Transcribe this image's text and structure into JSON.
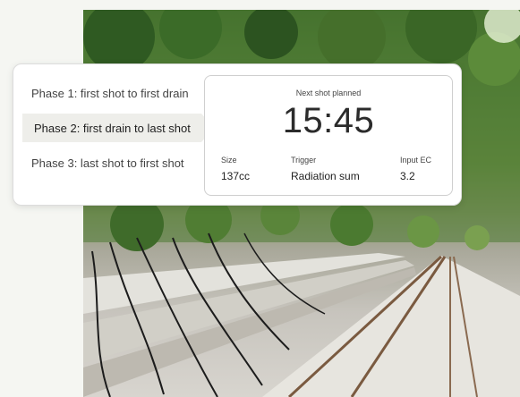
{
  "phases": {
    "phase1": "Phase 1: first shot to first drain",
    "phase2": "Phase 2: first drain to last shot",
    "phase3": "Phase 3: last shot to first shot",
    "active_index": 2
  },
  "next_shot": {
    "caption": "Next shot planned",
    "time": "15:45",
    "size_label": "Size",
    "size_value": "137cc",
    "trigger_label": "Trigger",
    "trigger_value": "Radiation sum",
    "ec_label": "Input EC",
    "ec_value": "3.2"
  },
  "colors": {
    "page_background": "#f5f6f2",
    "card_background": "#ffffff",
    "active_phase_background": "#eeeeea",
    "foliage": "#3e6a2a"
  }
}
